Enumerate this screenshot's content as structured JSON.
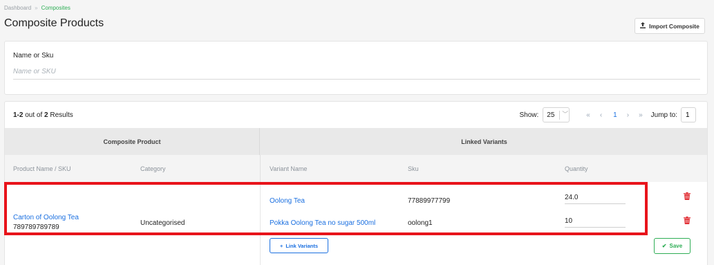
{
  "breadcrumb": {
    "home": "Dashboard",
    "separator": "»",
    "current": "Composites"
  },
  "page": {
    "title": "Composite Products"
  },
  "toolbar": {
    "import_label": "Import Composite"
  },
  "filter": {
    "label": "Name or Sku",
    "placeholder": "Name or SKU",
    "value": ""
  },
  "results": {
    "range": "1-2",
    "out_of_text": "out of",
    "total": "2",
    "suffix": "Results",
    "show_label": "Show:",
    "page_size": "25",
    "first": "«",
    "prev": "‹",
    "current_page": "1",
    "next": "›",
    "last": "»",
    "jump_label": "Jump to:",
    "jump_value": "1"
  },
  "table": {
    "group_headers": {
      "composite": "Composite Product",
      "linked": "Linked Variants"
    },
    "columns": {
      "product": "Product Name / SKU",
      "category": "Category",
      "variant_name": "Variant Name",
      "sku": "Sku",
      "quantity": "Quantity"
    },
    "composite": {
      "name": "Carton of Oolong Tea",
      "sku": "789789789789",
      "category": "Uncategorised"
    },
    "variants": [
      {
        "name": "Oolong Tea",
        "sku": "77889977799",
        "quantity": "24.0"
      },
      {
        "name": "Pokka Oolong Tea no sugar 500ml",
        "sku": "oolong1",
        "quantity": "10"
      }
    ],
    "link_variants_label": "Link Variants",
    "save_label": "Save"
  },
  "colors": {
    "accent_blue": "#1a6fe0",
    "success_green": "#2eae55",
    "danger_red": "#e0262c",
    "highlight_red": "#e8141b"
  }
}
